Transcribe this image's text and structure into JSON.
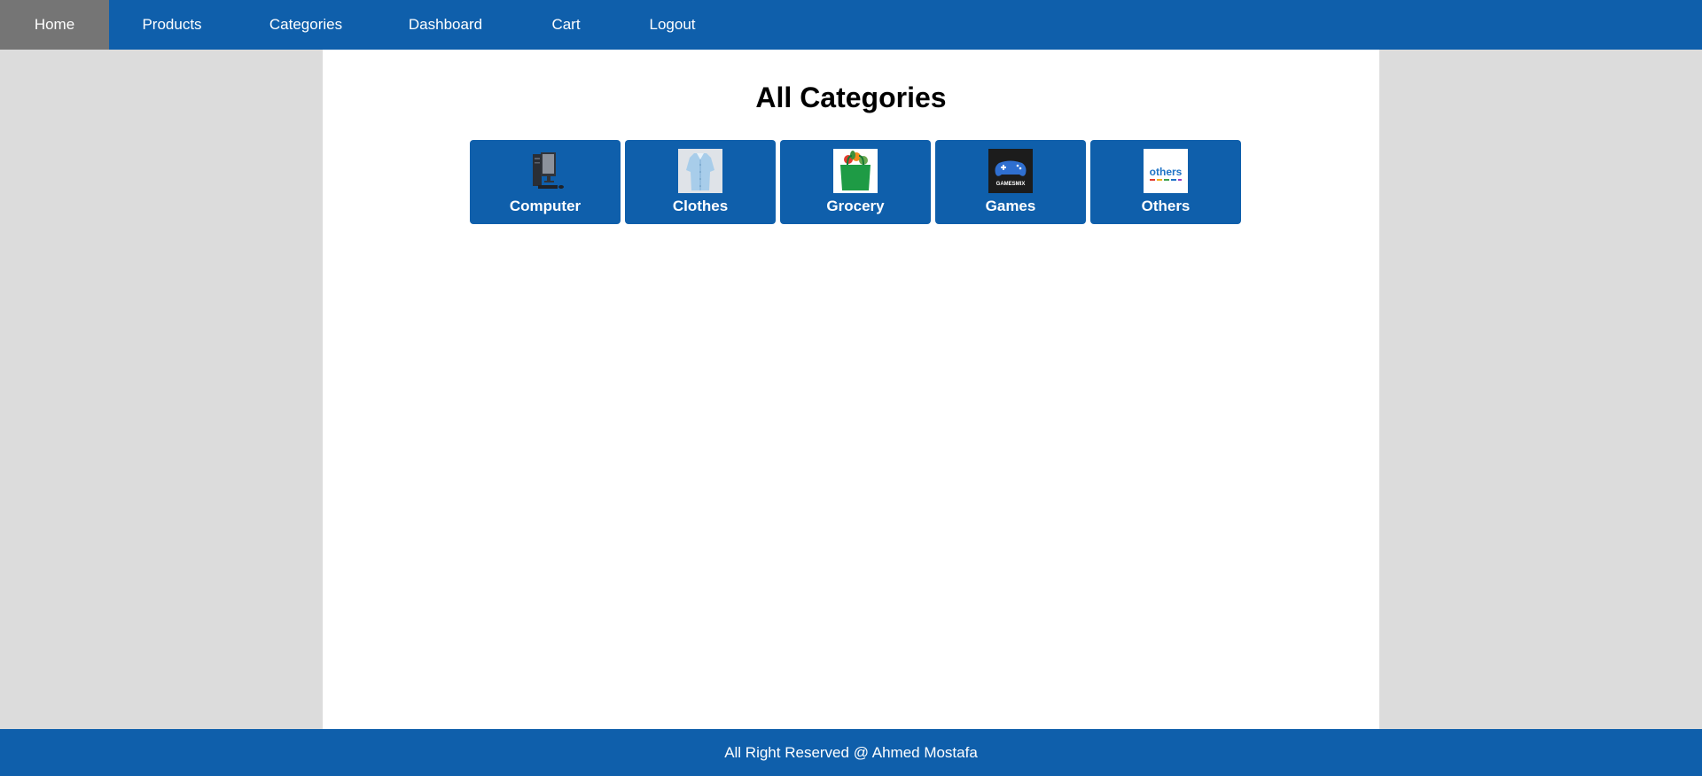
{
  "nav": {
    "items": [
      {
        "label": "Home",
        "active": true
      },
      {
        "label": "Products",
        "active": false
      },
      {
        "label": "Categories",
        "active": false
      },
      {
        "label": "Dashboard",
        "active": false
      },
      {
        "label": "Cart",
        "active": false
      },
      {
        "label": "Logout",
        "active": false
      }
    ]
  },
  "main": {
    "title": "All Categories",
    "categories": [
      {
        "label": "Computer",
        "icon": "computer-icon"
      },
      {
        "label": "Clothes",
        "icon": "shirt-icon"
      },
      {
        "label": "Grocery",
        "icon": "grocery-bag-icon"
      },
      {
        "label": "Games",
        "icon": "gamepad-icon",
        "image_text": "GAMESMIX"
      },
      {
        "label": "Others",
        "icon": "others-icon",
        "image_text": "others"
      }
    ]
  },
  "footer": {
    "text": "All Right Reserved @ Ahmed Mostafa"
  },
  "colors": {
    "primary": "#0f5fab",
    "nav_active": "#757575",
    "page_bg": "#dcdcdc",
    "content_bg": "#ffffff"
  }
}
